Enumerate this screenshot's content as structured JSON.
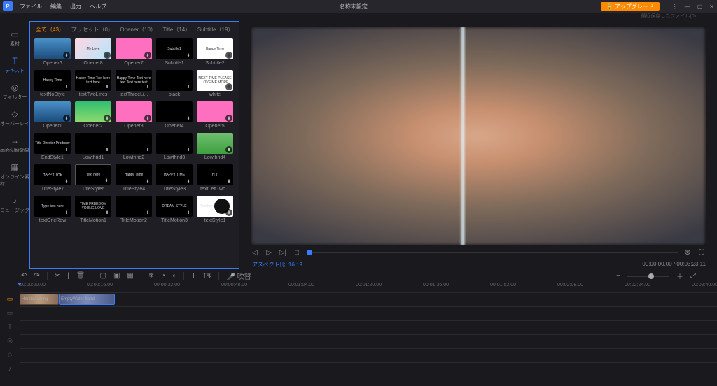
{
  "menu": [
    "ファイル",
    "編集",
    "出力",
    "ヘルプ"
  ],
  "title": "名称未設定",
  "upgrade_label": "アップグレード",
  "recent_label": "最近保存したファイル(0)",
  "sidenav": [
    {
      "icon": "▭",
      "label": "素材"
    },
    {
      "icon": "T",
      "label": "テキスト"
    },
    {
      "icon": "◎",
      "label": "フィルター"
    },
    {
      "icon": "◇",
      "label": "オーバーレイ"
    },
    {
      "icon": "↔",
      "label": "画面切替効果"
    },
    {
      "icon": "▦",
      "label": "オンライン素材"
    },
    {
      "icon": "♪",
      "label": "ミュージック"
    }
  ],
  "library_tabs": [
    {
      "label": "全て（43）",
      "active": true
    },
    {
      "label": "プリセット（0）"
    },
    {
      "label": "Opener（10）"
    },
    {
      "label": "Title（14）"
    },
    {
      "label": "Subtitle（19）"
    }
  ],
  "thumbs": [
    [
      {
        "label": "Opener6",
        "cls": "t-opener6",
        "txt": ""
      },
      {
        "label": "Opener8",
        "cls": "t-opener8",
        "txt": "My Love"
      },
      {
        "label": "Opener7",
        "cls": "t-opener7",
        "txt": ""
      },
      {
        "label": "Subtitle1",
        "cls": "",
        "txt": "Subtitle1"
      },
      {
        "label": "Subtitle2",
        "cls": "t-white",
        "txt": "Happy Time"
      }
    ],
    [
      {
        "label": "textNoStyle",
        "cls": "",
        "txt": "Happy Time"
      },
      {
        "label": "textTwoLines",
        "cls": "",
        "txt": "Happy Time Text here text here"
      },
      {
        "label": "textThreeLi...",
        "cls": "",
        "txt": "Happy Time Text here text Text here text"
      },
      {
        "label": "black",
        "cls": "",
        "txt": ""
      },
      {
        "label": "white",
        "cls": "t-white",
        "txt": "NEXT TIME PLEASE LOVE ME MORE"
      }
    ],
    [
      {
        "label": "Opener1",
        "cls": "t-opener6",
        "txt": ""
      },
      {
        "label": "Opener2",
        "cls": "t-green",
        "txt": ""
      },
      {
        "label": "Opener3",
        "cls": "t-pink",
        "txt": ""
      },
      {
        "label": "Opener4",
        "cls": "",
        "txt": ""
      },
      {
        "label": "Opener5",
        "cls": "t-opener7",
        "txt": ""
      }
    ],
    [
      {
        "label": "EndStyle1",
        "cls": "",
        "txt": "Title Director Producer"
      },
      {
        "label": "Lowthrid1",
        "cls": "",
        "txt": ""
      },
      {
        "label": "Lowthrid2",
        "cls": "",
        "txt": ""
      },
      {
        "label": "Lowthrid3",
        "cls": "",
        "txt": ""
      },
      {
        "label": "Lowthrid4",
        "cls": "t-lowgreen",
        "txt": ""
      }
    ],
    [
      {
        "label": "TitleStyle7",
        "cls": "",
        "txt": "HAPPY THE"
      },
      {
        "label": "TitleStyle6",
        "cls": "t-border",
        "txt": "Text here"
      },
      {
        "label": "TitleStyle4",
        "cls": "",
        "txt": "Happy Time"
      },
      {
        "label": "TitleStyle3",
        "cls": "",
        "txt": "HAPPY TIME"
      },
      {
        "label": "textLeftTwo...",
        "cls": "",
        "txt": "H T"
      }
    ],
    [
      {
        "label": "textOneRow",
        "cls": "",
        "txt": "Type text here"
      },
      {
        "label": "TitleMotion1",
        "cls": "",
        "txt": "TIME FREEDOM YOUNG LOVE"
      },
      {
        "label": "TitleMotion2",
        "cls": "",
        "txt": ""
      },
      {
        "label": "TitleMotion3",
        "cls": "",
        "txt": "DREAM STYLE"
      },
      {
        "label": "textStyle1",
        "cls": "t-circle",
        "txt": "Text here"
      }
    ]
  ],
  "aspect": {
    "label": "アスペクト比",
    "value": "16 : 9"
  },
  "timecode": "00:00:00.00 / 00:03:23.11",
  "toolbar": {
    "undo": "↶",
    "redo": "↷",
    "cut": "✂",
    "split": "|",
    "copy": "⧉",
    "crop": "▢",
    "audiowave": "≈",
    "speed": "◔",
    "color": "◐",
    "text": "T",
    "export": "⇪",
    "voiceover": "🎤",
    "vo_label": "吹替",
    "fit": "⤢"
  },
  "ruler_ticks": [
    "00:00:00.00",
    "00:00:16.00",
    "00:00:32.00",
    "00:00:48.00",
    "00:01:04.00",
    "00:01:20.00",
    "00:01:36.00",
    "00:01:52.00",
    "00:02:08.00",
    "00:02:24.00",
    "00:02:40.00"
  ],
  "clips": [
    {
      "name": "HandWashing"
    },
    {
      "name": "EmptyWater hand"
    }
  ],
  "track_icons": [
    "▭",
    "▭",
    "T",
    "◎",
    "◇",
    "♪"
  ]
}
